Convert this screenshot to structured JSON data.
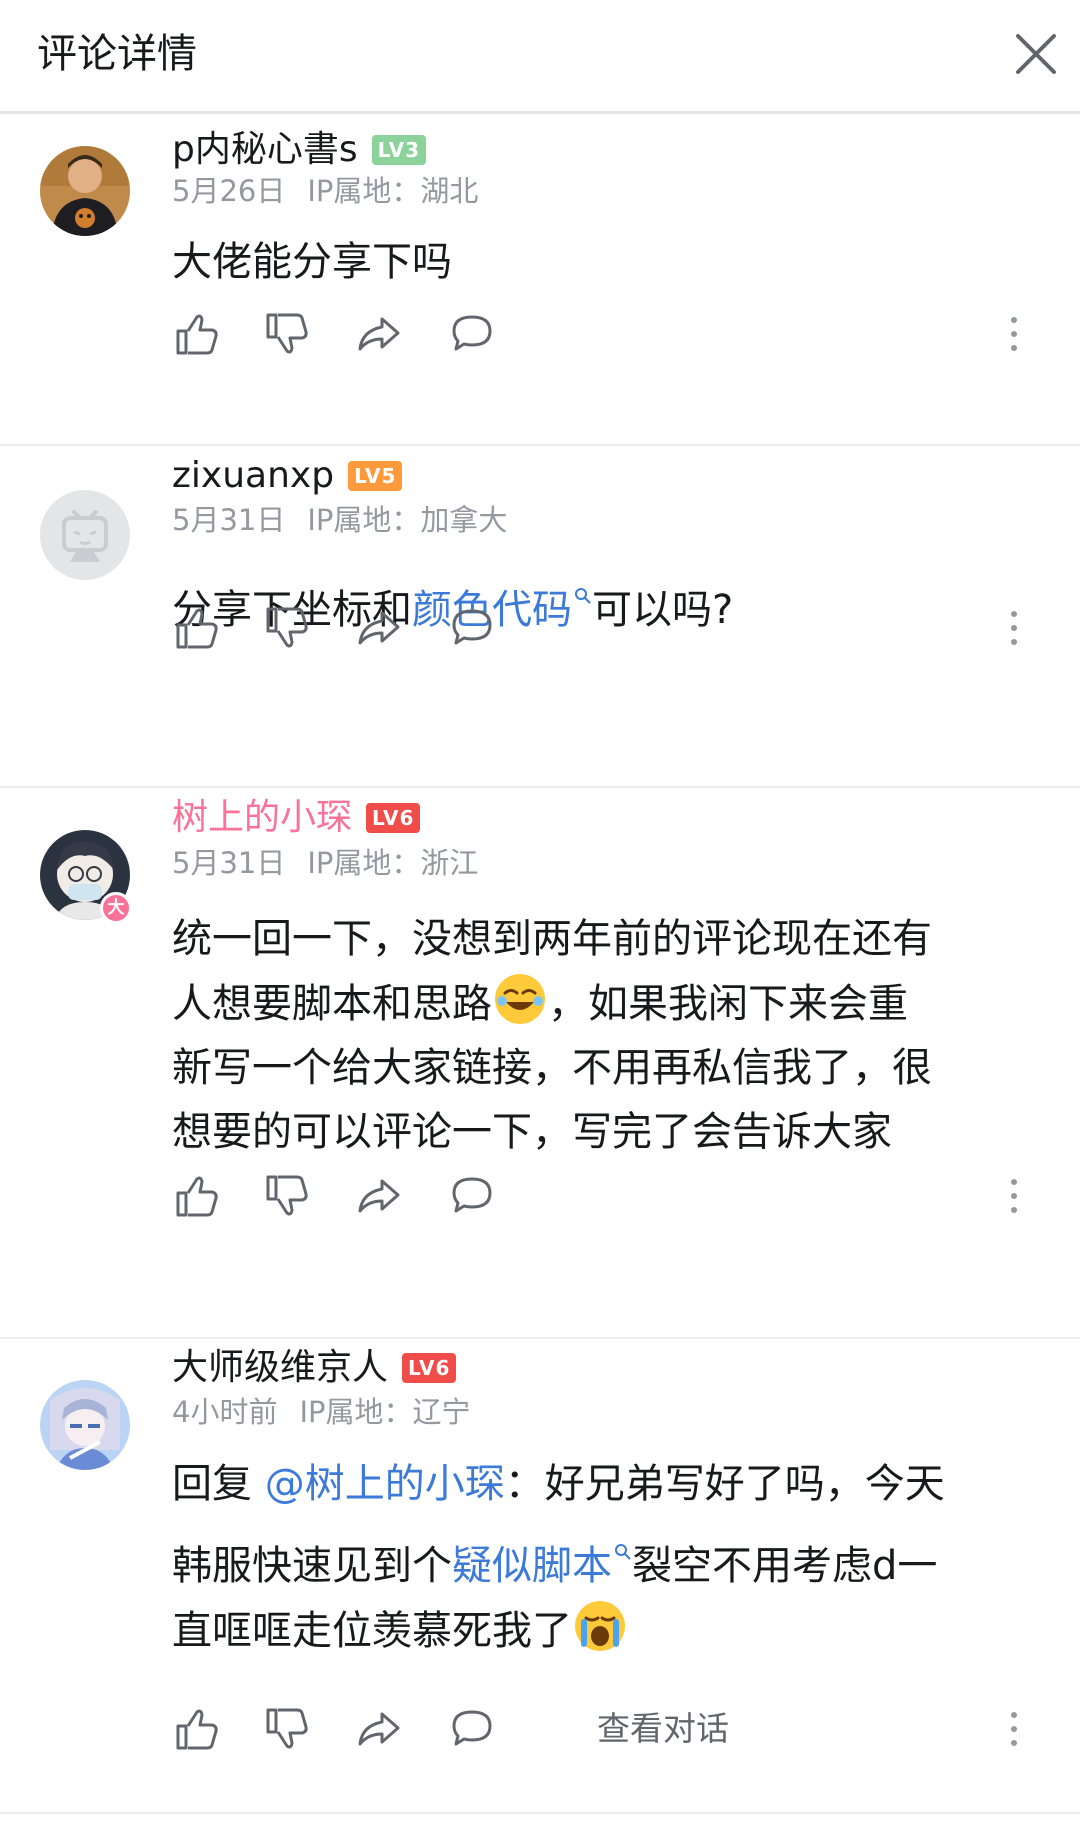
{
  "header": {
    "title": "评论详情"
  },
  "comments": [
    {
      "username": "p内秘心書s",
      "level": "LV3",
      "date": "5月26日",
      "ip": "IP属地：湖北",
      "text": "大佬能分享下吗"
    },
    {
      "username": "zixuanxp",
      "level": "LV5",
      "date": "5月31日",
      "ip": "IP属地：加拿大",
      "text_before": "分享下坐标和",
      "link": "颜色代码",
      "text_after": "可以吗?"
    },
    {
      "username": "树上的小琛",
      "level": "LV6",
      "date": "5月31日",
      "ip": "IP属地：浙江",
      "badge": "大",
      "text_line1": "统一回一下，没想到两年前的评论现在还有",
      "text_line2a": "人想要脚本和思路",
      "text_line2b": "，如果我闲下来会重",
      "text_line3": "新写一个给大家链接，不用再私信我了，很",
      "text_line4": "想要的可以评论一下，写完了会告诉大家"
    },
    {
      "username": "大师级维京人",
      "level": "LV6",
      "date": "4小时前",
      "ip": "IP属地：辽宁",
      "reply_prefix": "回复 ",
      "mention": "@树上的小琛",
      "line1_after": "：好兄弟写好了吗，今天",
      "line2_before": "韩服快速见到个",
      "link": "疑似脚本",
      "line2_after": "裂空不用考虑d一",
      "line3": "直哐哐走位羡慕死我了",
      "view_conversation": "查看对话"
    }
  ],
  "colors": {
    "link": "#3b7ad9",
    "pink_name": "#fb7299",
    "meta": "#9499a0"
  },
  "icons": [
    "close-icon",
    "like-icon",
    "dislike-icon",
    "share-icon",
    "reply-icon",
    "more-icon",
    "search-icon"
  ]
}
